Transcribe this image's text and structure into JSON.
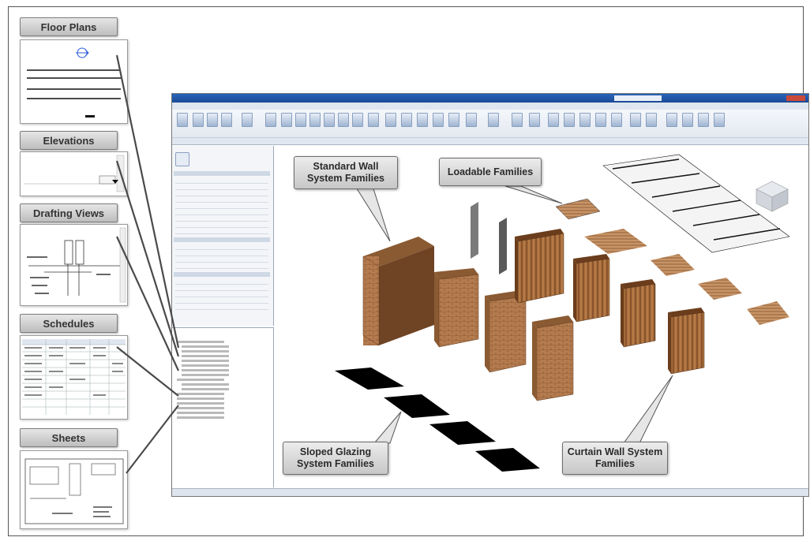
{
  "views": {
    "floor_plans": "Floor Plans",
    "elevations": "Elevations",
    "drafting_views": "Drafting Views",
    "schedules": "Schedules",
    "sheets": "Sheets"
  },
  "callouts": {
    "standard_wall": "Standard Wall System Families",
    "loadable": "Loadable Families",
    "sloped_glazing": "Sloped Glazing System Families",
    "curtain_wall": "Curtain Wall System Families"
  },
  "colors": {
    "wall_brick": "#b07a4f",
    "wall_wood": "#8a5a32",
    "titlebar": "#1b4a96",
    "glazing": "#000000"
  },
  "icons": [
    "view-cube-icon",
    "ribbon-tool-icon",
    "project-browser-tree-icon"
  ]
}
